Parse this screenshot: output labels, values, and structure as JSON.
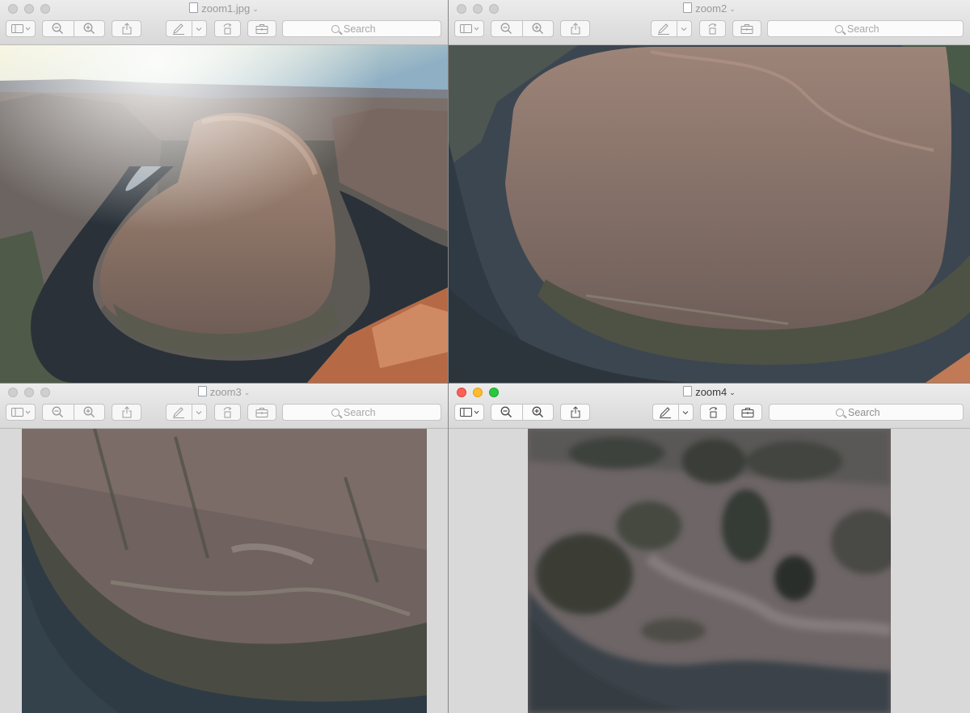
{
  "windows": [
    {
      "id": "zoom1",
      "title": "zoom1.jpg",
      "active": false,
      "search_placeholder": "Search"
    },
    {
      "id": "zoom2",
      "title": "zoom2",
      "active": false,
      "search_placeholder": "Search"
    },
    {
      "id": "zoom3",
      "title": "zoom3",
      "active": false,
      "search_placeholder": "Search"
    },
    {
      "id": "zoom4",
      "title": "zoom4",
      "active": true,
      "search_placeholder": "Search"
    }
  ],
  "icons": {
    "sidebar": "sidebar-toggle-icon",
    "zoom_out": "zoom-out-icon",
    "zoom_in": "zoom-in-icon",
    "share": "share-icon",
    "markup": "markup-pen-icon",
    "rotate": "rotate-icon",
    "toolbox": "toolbox-icon",
    "search": "search-icon"
  },
  "colors": {
    "close": "#fc5f57",
    "minimize": "#fdbc2e",
    "zoom": "#28c840"
  }
}
